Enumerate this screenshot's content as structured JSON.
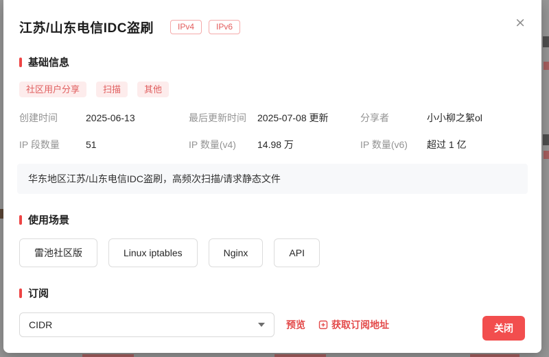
{
  "modal": {
    "title": "江苏/山东电信IDC盗刷",
    "badges": {
      "ipv4": "IPv4",
      "ipv6": "IPv6"
    },
    "close_icon": "×",
    "basic": {
      "heading": "基础信息",
      "tags": [
        "社区用户分享",
        "扫描",
        "其他"
      ],
      "fields": [
        {
          "label": "创建时间",
          "value": "2025-06-13"
        },
        {
          "label": "最后更新时间",
          "value": "2025-07-08 更新"
        },
        {
          "label": "分享者",
          "value": "小小柳之絮ol"
        },
        {
          "label": "IP 段数量",
          "value": "51"
        },
        {
          "label": "IP 数量(v4)",
          "value": "14.98 万"
        },
        {
          "label": "IP 数量(v6)",
          "value": "超过 1 亿"
        }
      ],
      "description": "华东地区江苏/山东电信IDC盗刷，高频次扫描/请求静态文件"
    },
    "usage": {
      "heading": "使用场景",
      "options": [
        "雷池社区版",
        "Linux iptables",
        "Nginx",
        "API"
      ]
    },
    "subscribe": {
      "heading": "订阅",
      "format_selected": "CIDR",
      "preview_label": "预览",
      "get_address_label": "获取订阅地址"
    },
    "footer": {
      "close_label": "关闭"
    }
  },
  "colors": {
    "accent_red": "#ee4545",
    "tag_bg": "#fdecec",
    "tag_text": "#e05e5e",
    "badge_border": "#f5a9a9",
    "close_button_bg": "#f24e4e",
    "description_bg": "#f7f8fa",
    "label_grey": "#939393",
    "overlay_grey": "#969696"
  }
}
